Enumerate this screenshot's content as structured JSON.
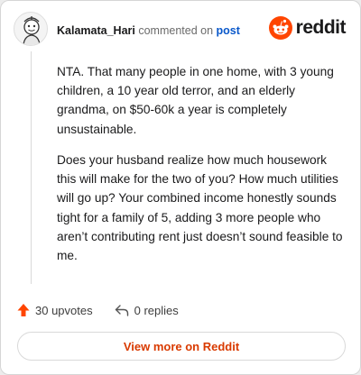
{
  "comment": {
    "username": "Kalamata_Hari",
    "action_text": "commented on",
    "post_link": "post",
    "paragraphs": [
      "NTA. That many people in one home, with 3 young children, a 10 year old terror, and an elderly grandma, on $50-60k a year is completely unsustainable.",
      "Does your husband realize how much housework this will make for the two of you? How much utilities will go up? Your combined income honestly sounds tight for a family of 5, adding 3 more people who aren’t contributing rent just doesn’t sound feasible to me."
    ]
  },
  "brand": {
    "name": "reddit",
    "color": "#ff4500"
  },
  "actions": {
    "upvotes": "30 upvotes",
    "replies": "0 replies"
  },
  "view_more": "View more on Reddit",
  "colors": {
    "accent": "#d93a00",
    "link": "#0a58ca",
    "upvote": "#ff4500"
  }
}
